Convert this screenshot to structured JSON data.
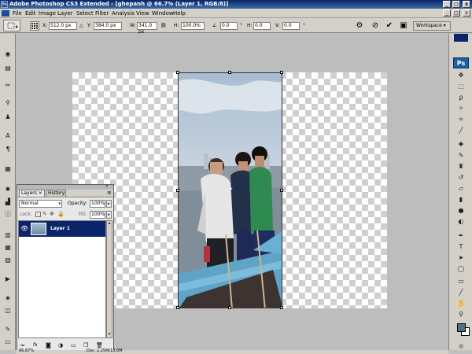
{
  "window": {
    "title": "Adobe Photoshop CS3 Extended - [ghepanh @ 66.7% (Layer 1, RGB/8)]",
    "app_icon": "Ps",
    "min_label": "_",
    "max_label": "□",
    "close_label": "x"
  },
  "menu": [
    "File",
    "Edit",
    "Image",
    "Layer",
    "Select",
    "Filter",
    "Analysis",
    "View",
    "Window",
    "Help"
  ],
  "options": {
    "x_label": "X:",
    "x_value": "512.0 px",
    "y_label": "Y:",
    "y_value": "384.0 px",
    "w_label": "W:",
    "w_value": "341.0 px",
    "h_label": "H:",
    "h_value": "100.0%",
    "angle_value": "0.0",
    "hskew_label": "H:",
    "hskew_value": "0.0",
    "vskew_label": "V:",
    "vskew_value": "0.0",
    "workspace_label": "Workspace"
  },
  "toolbox": {
    "ps_label": "Ps"
  },
  "layers_panel": {
    "tabs": [
      "Layers",
      "History"
    ],
    "close_glyph": "×",
    "blend_mode": "Normal",
    "opacity_label": "Opacity:",
    "opacity_value": "100%",
    "lock_label": "Lock:",
    "fill_label": "Fill:",
    "fill_value": "100%",
    "layers": [
      {
        "name": "Layer 1",
        "selected": true
      }
    ],
    "bottom_icons": [
      "link-icon",
      "fx-icon",
      "mask-icon",
      "adjustment-icon",
      "folder-icon",
      "new-layer-icon",
      "trash-icon"
    ]
  },
  "status": {
    "zoom": "66.67%",
    "doc": "Doc: 2.25M/13.0M"
  },
  "colors": {
    "selection": "#0a246a",
    "foreground": "#4f6f8f",
    "background": "#ffffff"
  }
}
